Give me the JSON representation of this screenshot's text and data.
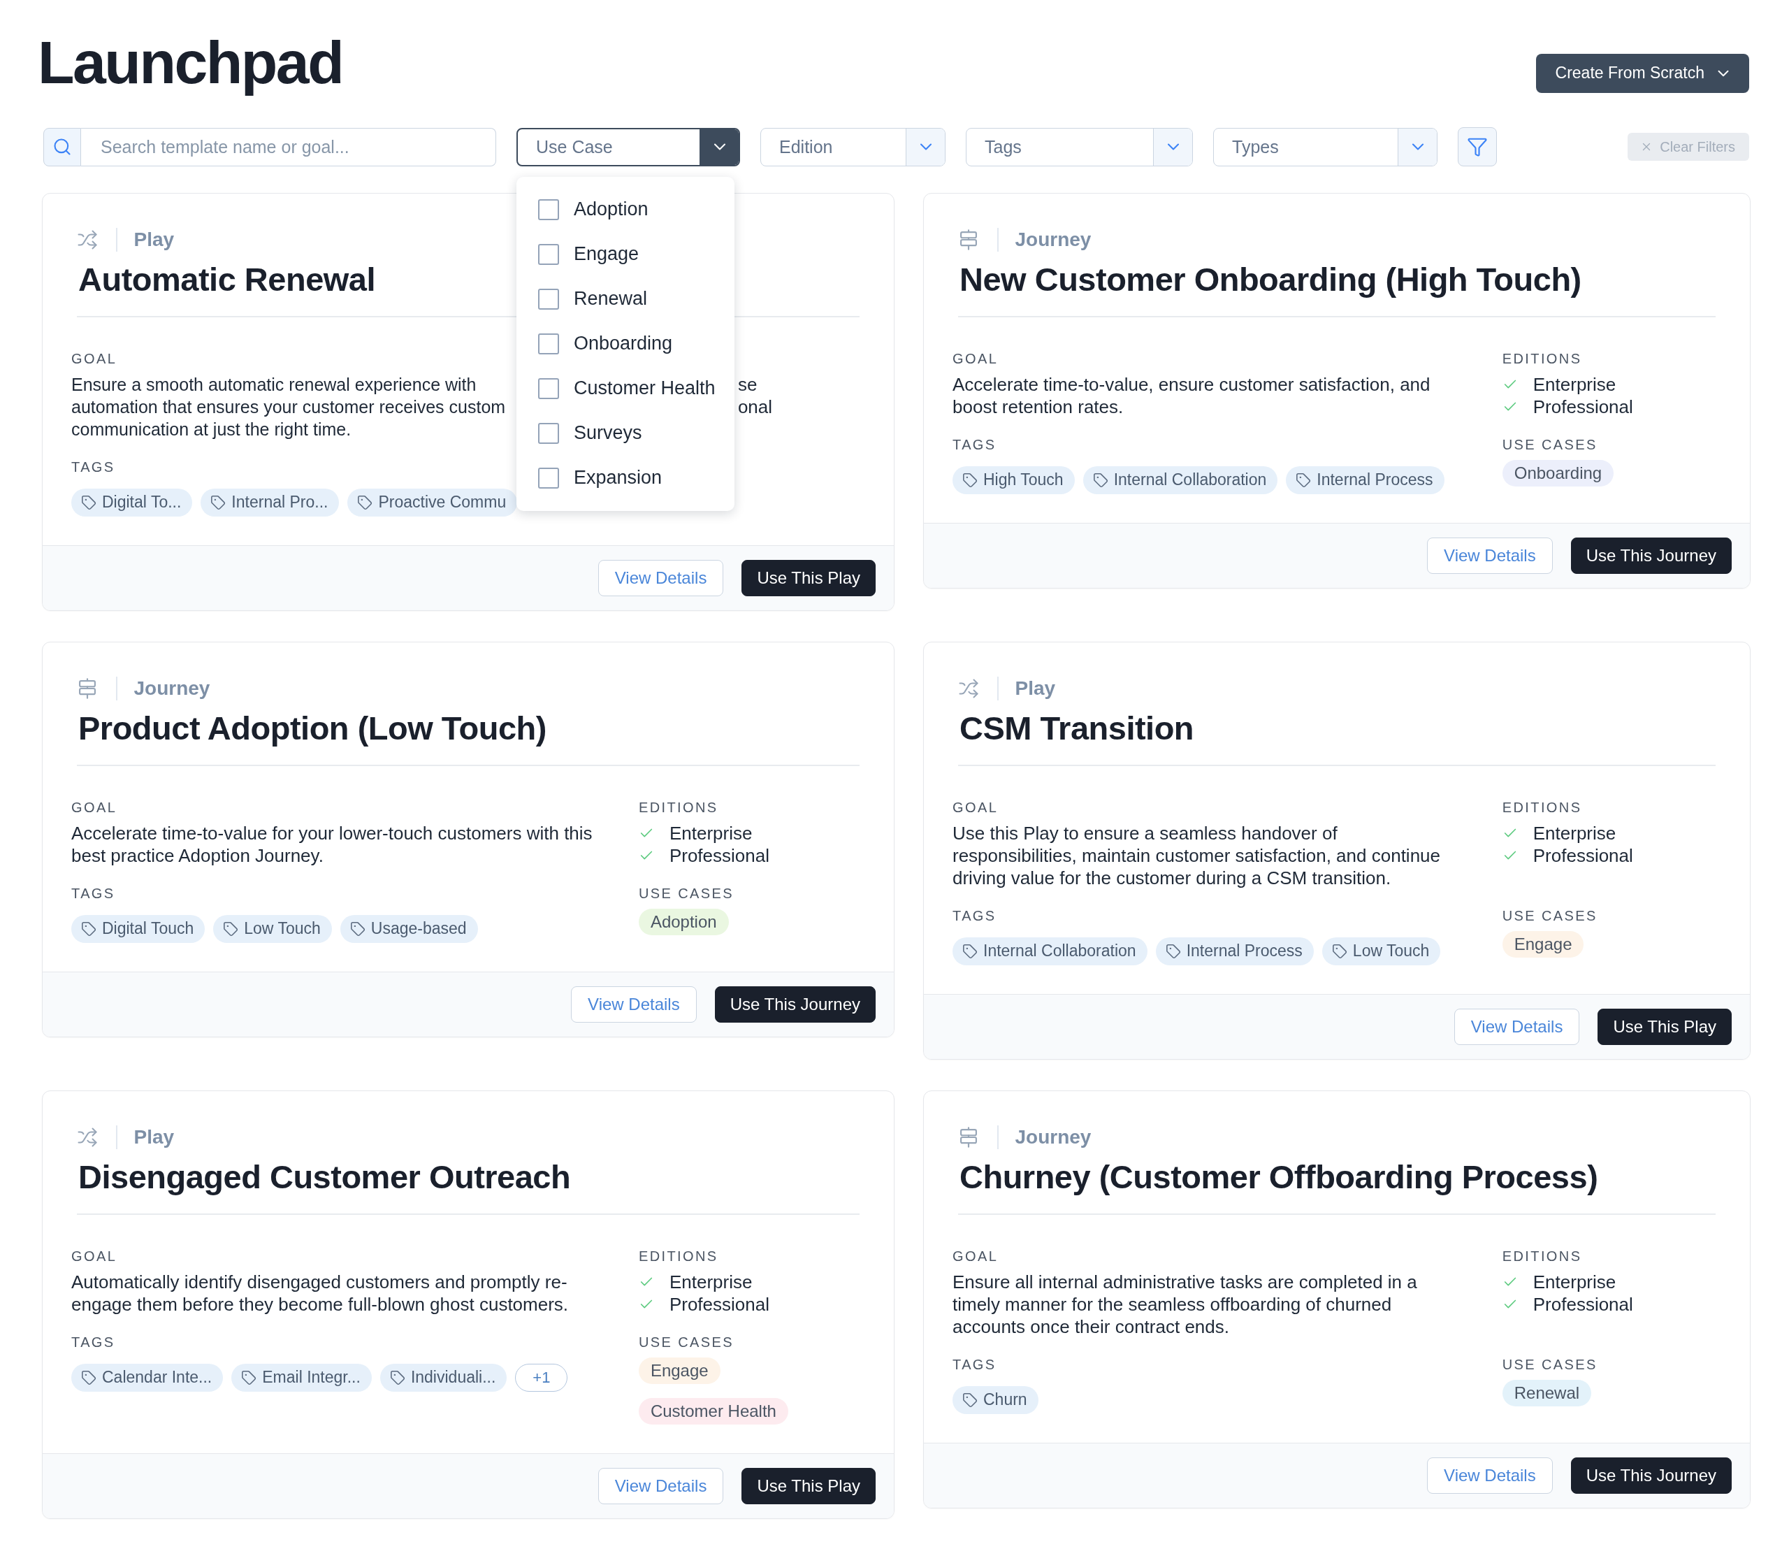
{
  "page": {
    "title": "Launchpad"
  },
  "create_button": {
    "label": "Create From Scratch"
  },
  "search": {
    "placeholder": "Search template name or goal..."
  },
  "filters": [
    {
      "placeholder": "Use Case",
      "expanded": true,
      "options": [
        {
          "label": "Adoption",
          "checked": false
        },
        {
          "label": "Engage",
          "checked": false
        },
        {
          "label": "Renewal",
          "checked": false
        },
        {
          "label": "Onboarding",
          "checked": false
        },
        {
          "label": "Customer Health",
          "checked": false
        },
        {
          "label": "Surveys",
          "checked": false
        },
        {
          "label": "Expansion",
          "checked": false
        }
      ]
    },
    {
      "placeholder": "Edition",
      "expanded": false
    },
    {
      "placeholder": "Tags",
      "expanded": false
    },
    {
      "placeholder": "Types",
      "expanded": false
    }
  ],
  "clear_filters": {
    "label": "Clear Filters",
    "disabled": true
  },
  "cards": [
    {
      "type": {
        "kind": "play",
        "label": "Play"
      },
      "title": "Automatic Renewal",
      "goal": {
        "label": "GOAL",
        "lines": [
          "Ensure a smooth automatic renewal experience with",
          "automation that ensures your customer receives custom",
          "communication at just the right time."
        ]
      },
      "editions": {
        "items": [
          {
            "kind": "tail",
            "label": "se"
          },
          {
            "kind": "tail",
            "label": "onal"
          }
        ]
      },
      "tags": {
        "label": "TAGS",
        "items": [
          "Digital To...",
          "Internal Pro...",
          "Proactive Commu"
        ]
      },
      "actions": [
        {
          "kind": "secondary",
          "label": "View Details"
        },
        {
          "kind": "primary",
          "label": "Use This Play"
        }
      ]
    },
    {
      "type": {
        "kind": "journey",
        "label": "Journey"
      },
      "title": "New Customer Onboarding (High Touch)",
      "goal": {
        "label": "GOAL",
        "text": "Accelerate time-to-value, ensure customer satisfaction, and boost retention rates."
      },
      "editions": {
        "label": "EDITIONS",
        "items": [
          {
            "kind": "check",
            "label": "Enterprise"
          },
          {
            "kind": "check",
            "label": "Professional"
          }
        ]
      },
      "tags": {
        "label": "TAGS",
        "items": [
          "High Touch",
          "Internal Collaboration",
          "Internal Process"
        ]
      },
      "use_cases": {
        "label": "USE CASES",
        "items": [
          {
            "label": "Onboarding",
            "color": "#eceffb"
          }
        ]
      },
      "actions": [
        {
          "kind": "secondary",
          "label": "View Details"
        },
        {
          "kind": "primary",
          "label": "Use This Journey"
        }
      ]
    },
    {
      "type": {
        "kind": "journey",
        "label": "Journey"
      },
      "title": "Product Adoption (Low Touch)",
      "goal": {
        "label": "GOAL",
        "text": "Accelerate time-to-value for your lower-touch customers with this best practice Adoption Journey."
      },
      "editions": {
        "label": "EDITIONS",
        "items": [
          {
            "kind": "check",
            "label": "Enterprise"
          },
          {
            "kind": "check",
            "label": "Professional"
          }
        ]
      },
      "tags": {
        "label": "TAGS",
        "items": [
          "Digital Touch",
          "Low Touch",
          "Usage-based"
        ]
      },
      "use_cases": {
        "label": "USE CASES",
        "items": [
          {
            "label": "Adoption",
            "color": "#eaf7e1"
          }
        ]
      },
      "actions": [
        {
          "kind": "secondary",
          "label": "View Details"
        },
        {
          "kind": "primary",
          "label": "Use This Journey"
        }
      ]
    },
    {
      "type": {
        "kind": "play",
        "label": "Play"
      },
      "title": "CSM Transition",
      "goal": {
        "label": "GOAL",
        "text": "Use this Play to ensure a seamless handover of responsibilities, maintain customer satisfaction, and continue driving value for the customer during a CSM transition."
      },
      "editions": {
        "label": "EDITIONS",
        "items": [
          {
            "kind": "check",
            "label": "Enterprise"
          },
          {
            "kind": "check",
            "label": "Professional"
          }
        ]
      },
      "tags": {
        "label": "TAGS",
        "items": [
          "Internal Collaboration",
          "Internal Process",
          "Low Touch"
        ]
      },
      "use_cases": {
        "label": "USE CASES",
        "items": [
          {
            "label": "Engage",
            "color": "#fdf3e8"
          }
        ]
      },
      "actions": [
        {
          "kind": "secondary",
          "label": "View Details"
        },
        {
          "kind": "primary",
          "label": "Use This Play"
        }
      ]
    },
    {
      "type": {
        "kind": "play",
        "label": "Play"
      },
      "title": "Disengaged Customer Outreach",
      "goal": {
        "label": "GOAL",
        "text": "Automatically identify disengaged customers and promptly re-engage them before they become full-blown ghost customers."
      },
      "editions": {
        "label": "EDITIONS",
        "items": [
          {
            "kind": "check",
            "label": "Enterprise"
          },
          {
            "kind": "check",
            "label": "Professional"
          }
        ]
      },
      "tags": {
        "label": "TAGS",
        "items": [
          "Calendar Inte...",
          "Email Integr...",
          "Individuali..."
        ],
        "more": "+1"
      },
      "use_cases": {
        "label": "USE CASES",
        "items": [
          {
            "label": "Engage",
            "color": "#fdf3e8"
          },
          {
            "label": "Customer Health",
            "color": "#fdebef"
          }
        ]
      },
      "actions": [
        {
          "kind": "secondary",
          "label": "View Details"
        },
        {
          "kind": "primary",
          "label": "Use This Play"
        }
      ]
    },
    {
      "type": {
        "kind": "journey",
        "label": "Journey"
      },
      "title": "Churney (Customer Offboarding Process)",
      "goal": {
        "label": "GOAL",
        "text": "Ensure all internal administrative tasks are completed in a timely manner for the seamless offboarding of churned accounts once their contract ends."
      },
      "editions": {
        "label": "EDITIONS",
        "items": [
          {
            "kind": "check",
            "label": "Enterprise"
          },
          {
            "kind": "check",
            "label": "Professional"
          }
        ]
      },
      "tags": {
        "label": "TAGS",
        "items": [
          "Churn"
        ]
      },
      "use_cases": {
        "label": "USE CASES",
        "items": [
          {
            "label": "Renewal",
            "color": "#e3f2fa"
          }
        ]
      },
      "actions": [
        {
          "kind": "secondary",
          "label": "View Details"
        },
        {
          "kind": "primary",
          "label": "Use This Journey"
        }
      ]
    }
  ]
}
